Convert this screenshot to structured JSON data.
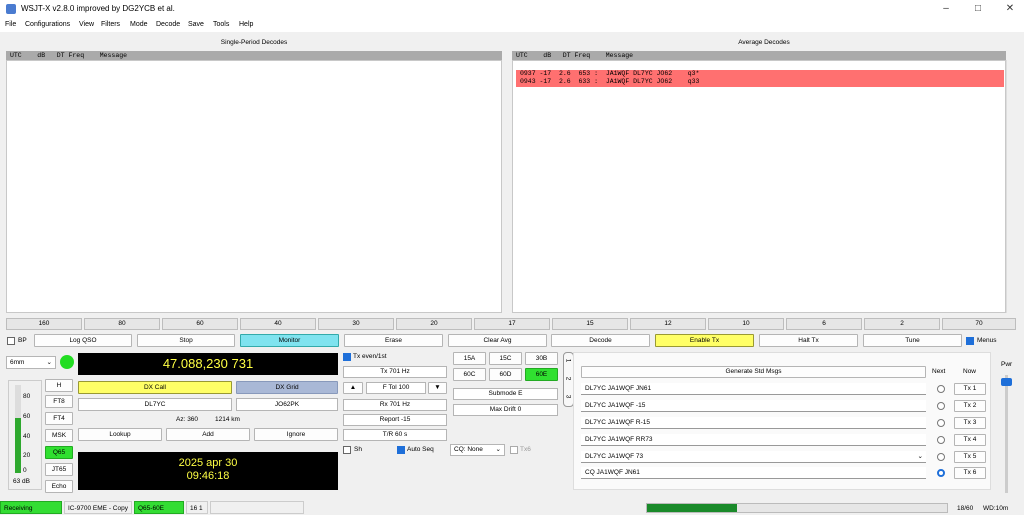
{
  "window": {
    "title": "WSJT-X   v2.8.0   improved by DG2YCB et al."
  },
  "menu": [
    "File",
    "Configurations",
    "View",
    "Filters",
    "Mode",
    "Decode",
    "Save",
    "Tools",
    "Help"
  ],
  "left_panel": {
    "title": "Single-Period Decodes",
    "header": "UTC    dB   DT Freq    Message"
  },
  "right_panel": {
    "title": "Average Decodes",
    "header": "UTC    dB   DT Freq    Message",
    "lines": [
      "0937 -17  2.6  653 :  JA1WQF DL7YC JO62    q3*",
      "0943 -17  2.6  633 :  JA1WQF DL7YC JO62    q33"
    ]
  },
  "bands": [
    "160",
    "80",
    "60",
    "40",
    "30",
    "20",
    "17",
    "15",
    "12",
    "10",
    "6",
    "2",
    "70"
  ],
  "buttons": {
    "bp": "BP",
    "log_qso": "Log QSO",
    "stop": "Stop",
    "monitor": "Monitor",
    "erase": "Erase",
    "clear_avg": "Clear Avg",
    "decode": "Decode",
    "enable_tx": "Enable Tx",
    "halt_tx": "Halt Tx",
    "tune": "Tune",
    "menus": "Menus"
  },
  "band_select": "6mm",
  "frequency": "47.088,230 731",
  "dx": {
    "call_label": "DX Call",
    "grid_label": "DX Grid",
    "call": "DL7YC",
    "grid": "JO62PK",
    "az": "Az: 360",
    "dist": "1214 km",
    "lookup": "Lookup",
    "add": "Add",
    "ignore": "Ignore"
  },
  "clock": {
    "date": "2025 apr 30",
    "time": "09:46:18"
  },
  "modes": [
    "H",
    "FT8",
    "FT4",
    "MSK",
    "Q65",
    "JT65",
    "Echo"
  ],
  "meter": {
    "ticks": [
      "80",
      "60",
      "40",
      "20",
      "0"
    ],
    "db": "63 dB",
    "level_fraction": 0.62
  },
  "tx": {
    "even_label": "Tx even/1st",
    "tx_freq": "Tx  701  Hz",
    "ftol": "F Tol  100",
    "rx_freq": "Rx  701  Hz",
    "report": "Report -15",
    "tr": "T/R  60  s",
    "sh": "Sh",
    "auto_seq": "Auto Seq",
    "cq": "CQ: None",
    "tx6": "Tx6",
    "up_arrow": "▲",
    "down_arrow": "▼"
  },
  "submodes": [
    "15A",
    "15C",
    "30B",
    "60C",
    "60D",
    "60E"
  ],
  "submode_select": "Submode E",
  "max_drift": "Max Drift  0",
  "tabs": [
    "1",
    "2",
    "3"
  ],
  "std_msgs": {
    "generate": "Generate Std Msgs",
    "next_label": "Next",
    "now_label": "Now",
    "messages": [
      "DL7YC JA1WQF JN61",
      "DL7YC JA1WQF -15",
      "DL7YC JA1WQF R-15",
      "DL7YC JA1WQF RR73",
      "DL7YC JA1WQF 73",
      "CQ JA1WQF JN61"
    ],
    "tx_labels": [
      "Tx 1",
      "Tx 2",
      "Tx 3",
      "Tx 4",
      "Tx 5",
      "Tx 6"
    ]
  },
  "pwr_label": "Pwr",
  "status": {
    "receiving": "Receiving",
    "rig": "IC-9700 EME - Copy",
    "mode": "Q65-60E",
    "seq": "16  1",
    "progress": "18/60",
    "wd": "WD:10m",
    "progress_fraction": 0.3
  }
}
